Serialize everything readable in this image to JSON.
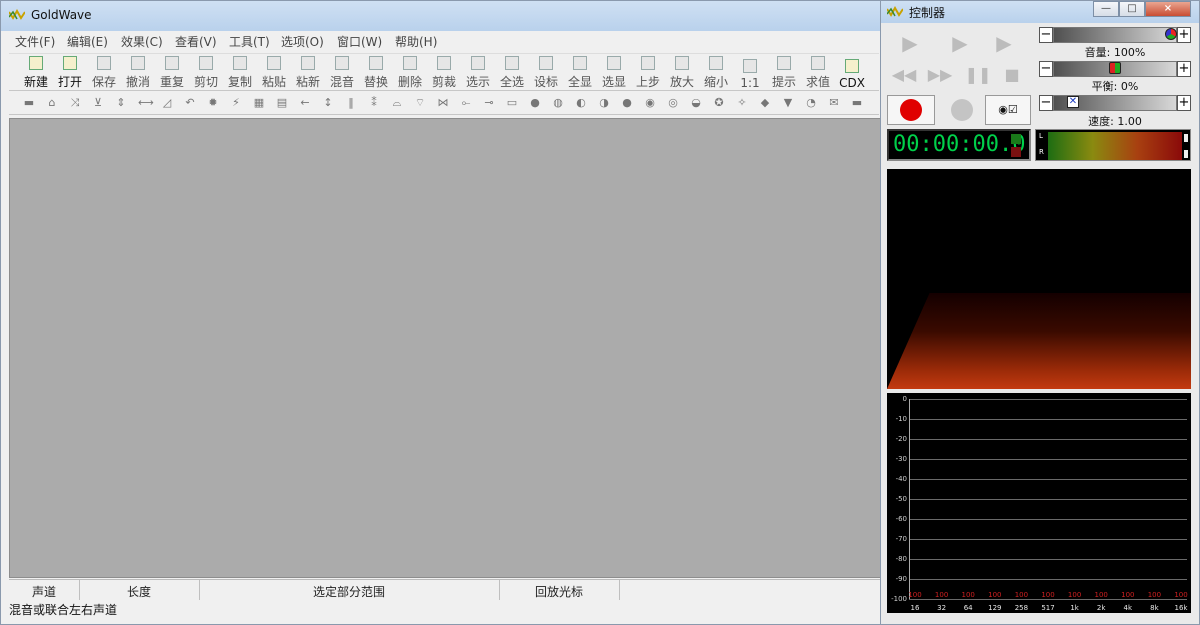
{
  "main_window": {
    "title": "GoldWave",
    "menu": [
      "文件(F)",
      "编辑(E)",
      "效果(C)",
      "查看(V)",
      "工具(T)",
      "选项(O)",
      "窗口(W)",
      "帮助(H)"
    ],
    "toolbar": [
      "新建",
      "打开",
      "保存",
      "撤消",
      "重复",
      "剪切",
      "复制",
      "粘贴",
      "粘新",
      "混音",
      "替换",
      "删除",
      "剪裁",
      "选示",
      "全选",
      "设标",
      "全显",
      "选显",
      "上步",
      "放大",
      "缩小",
      "1:1",
      "提示",
      "求值",
      "CDX"
    ],
    "status_columns": [
      "声道",
      "长度",
      "选定部分范围",
      "回放光标"
    ],
    "status_hint": "混音或联合左右声道"
  },
  "controller": {
    "title": "控制器",
    "volume_label": "音量: 100%",
    "balance_label": "平衡: 0%",
    "speed_label": "速度: 1.00",
    "volume_level": 1.0,
    "balance_level": 0.0,
    "speed_level": 1.0,
    "time": "00:00:00.0",
    "vu_channels": [
      "L",
      "R"
    ],
    "y_ticks": [
      "0",
      "-10",
      "-20",
      "-30",
      "-40",
      "-50",
      "-60",
      "-70",
      "-80",
      "-90",
      "-100"
    ],
    "x_ticks": [
      "16",
      "32",
      "64",
      "129",
      "258",
      "517",
      "1k",
      "2k",
      "4k",
      "8k",
      "16k"
    ],
    "band_levels": [
      "100",
      "100",
      "100",
      "100",
      "100",
      "100",
      "100",
      "100",
      "100",
      "100",
      "100"
    ]
  },
  "colors": {
    "accent_red": "#e00000",
    "time_green": "#00d04a",
    "canvas": "#ababab"
  }
}
